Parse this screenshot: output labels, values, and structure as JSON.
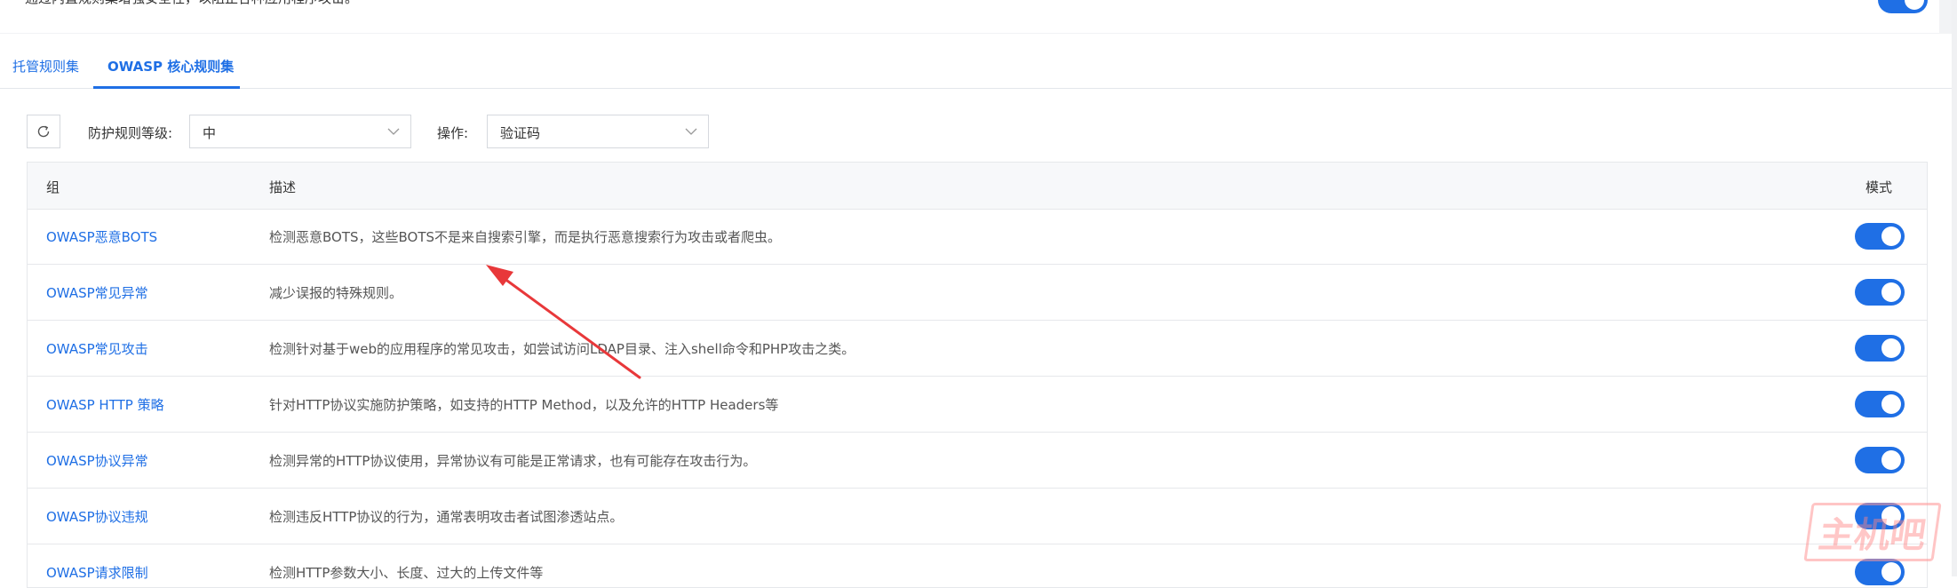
{
  "top": {
    "description": "通过内置规则集增强安全性，以阻止各种应用程序攻击。",
    "toggle_on": true
  },
  "tabs": [
    {
      "label": "托管规则集",
      "active": false
    },
    {
      "label": "OWASP 核心规则集",
      "active": true
    }
  ],
  "filters": {
    "refresh_icon": "refresh-icon",
    "level_label": "防护规则等级:",
    "level_value": "中",
    "action_label": "操作:",
    "action_value": "验证码"
  },
  "table": {
    "headers": {
      "group": "组",
      "description": "描述",
      "mode": "模式"
    },
    "rows": [
      {
        "group": "OWASP恶意BOTS",
        "description": "检测恶意BOTS，这些BOTS不是来自搜索引擎，而是执行恶意搜索行为攻击或者爬虫。",
        "enabled": true
      },
      {
        "group": "OWASP常见异常",
        "description": "减少误报的特殊规则。",
        "enabled": true
      },
      {
        "group": "OWASP常见攻击",
        "description": "检测针对基于web的应用程序的常见攻击，如尝试访问LDAP目录、注入shell命令和PHP攻击之类。",
        "enabled": true
      },
      {
        "group": "OWASP HTTP 策略",
        "description": "针对HTTP协议实施防护策略，如支持的HTTP Method，以及允许的HTTP Headers等",
        "enabled": true
      },
      {
        "group": "OWASP协议异常",
        "description": "检测异常的HTTP协议使用，异常协议有可能是正常请求，也有可能存在攻击行为。",
        "enabled": true
      },
      {
        "group": "OWASP协议违规",
        "description": "检测违反HTTP协议的行为，通常表明攻击者试图渗透站点。",
        "enabled": true
      },
      {
        "group": "OWASP请求限制",
        "description": "检测HTTP参数大小、长度、过大的上传文件等",
        "enabled": true
      }
    ]
  },
  "watermark": "主机吧",
  "colors": {
    "accent": "#1f6fe5",
    "arrow": "#e8383a"
  }
}
